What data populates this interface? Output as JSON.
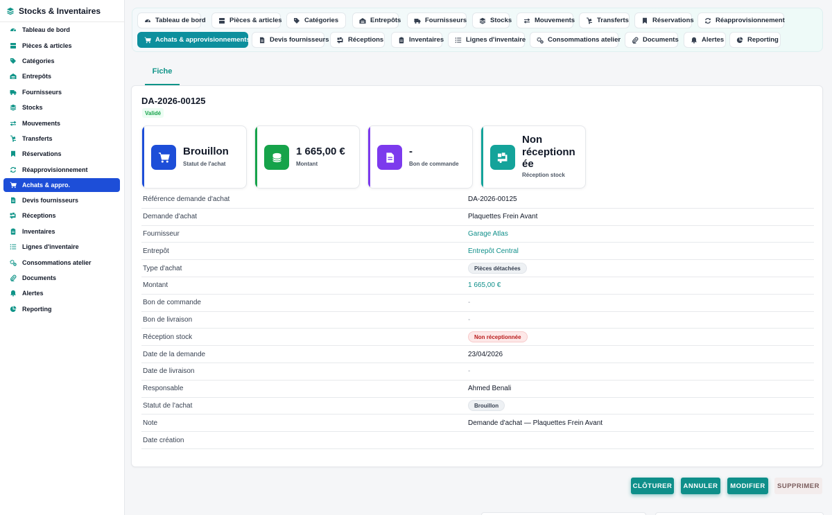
{
  "sidebar": {
    "title": "Stocks & Inventaires",
    "items": [
      {
        "label": "Tableau de bord",
        "icon": "dashboard-icon"
      },
      {
        "label": "Pièces & articles",
        "icon": "parts-icon"
      },
      {
        "label": "Catégories",
        "icon": "tags-icon"
      },
      {
        "label": "Entrepôts",
        "icon": "warehouse-icon"
      },
      {
        "label": "Fournisseurs",
        "icon": "truck-icon"
      },
      {
        "label": "Stocks",
        "icon": "layers-icon"
      },
      {
        "label": "Mouvements",
        "icon": "arrows-icon"
      },
      {
        "label": "Transferts",
        "icon": "dolly-icon"
      },
      {
        "label": "Réservations",
        "icon": "bookmark-icon"
      },
      {
        "label": "Réapprovisionnement",
        "icon": "refresh-icon"
      },
      {
        "label": "Achats & appro.",
        "icon": "cart-icon",
        "active": true
      },
      {
        "label": "Devis fournisseurs",
        "icon": "invoice-icon"
      },
      {
        "label": "Réceptions",
        "icon": "truck-loading-icon"
      },
      {
        "label": "Inventaires",
        "icon": "clipboard-icon"
      },
      {
        "label": "Lignes d'inventaire",
        "icon": "list-icon"
      },
      {
        "label": "Consommations atelier",
        "icon": "cogs-icon"
      },
      {
        "label": "Documents",
        "icon": "paperclip-icon"
      },
      {
        "label": "Alertes",
        "icon": "bell-icon"
      },
      {
        "label": "Reporting",
        "icon": "pie-chart-icon"
      }
    ]
  },
  "tabs": {
    "row1": [
      "Tableau de bord",
      "Pièces & articles",
      "Catégories",
      "Entrepôts",
      "Fournisseurs",
      "Stocks",
      "Mouvements",
      "Transferts",
      "Réservations",
      "Réapprovisionnement"
    ],
    "row2": [
      "Achats & approvisionnements",
      "Devis fournisseurs",
      "Réceptions",
      "Inventaires",
      "Lignes d'inventaire",
      "Consommations atelier",
      "Documents",
      "Alertes",
      "Reporting"
    ]
  },
  "subtab": "Fiche",
  "record": {
    "title": "DA-2026-00125",
    "status": "Validé"
  },
  "stats": [
    {
      "value": "Brouillon",
      "label": "Statut de l'achat",
      "color": "#1d4ed8",
      "icon": "cart-icon"
    },
    {
      "value": "1 665,00 €",
      "label": "Montant",
      "color": "#16a34a",
      "icon": "coins-icon"
    },
    {
      "value": "-",
      "label": "Bon de commande",
      "color": "#7c3aed",
      "icon": "document-icon"
    },
    {
      "value": "Non réceptionnée",
      "value_lines": [
        "Non",
        "réceptionn",
        "ée"
      ],
      "label": "Réception stock",
      "color": "#14a39a",
      "icon": "truck-loading-icon"
    }
  ],
  "fields": [
    {
      "key": "Référence demande d'achat",
      "value": "DA-2026-00125",
      "type": "text"
    },
    {
      "key": "Demande d'achat",
      "value": "Plaquettes Frein Avant",
      "type": "text"
    },
    {
      "key": "Fournisseur",
      "value": "Garage Atlas",
      "type": "link"
    },
    {
      "key": "Entrepôt",
      "value": "Entrepôt Central",
      "type": "link"
    },
    {
      "key": "Type d'achat",
      "value": "Pièces détachées",
      "type": "pill-gray"
    },
    {
      "key": "Montant",
      "value": "1 665,00 €",
      "type": "link"
    },
    {
      "key": "Bon de commande",
      "value": "-",
      "type": "dash"
    },
    {
      "key": "Bon de livraison",
      "value": "-",
      "type": "dash"
    },
    {
      "key": "Réception stock",
      "value": "Non réceptionnée",
      "type": "pill-red"
    },
    {
      "key": "Date de la demande",
      "value": "23/04/2026",
      "type": "text"
    },
    {
      "key": "Date de livraison",
      "value": "-",
      "type": "dash"
    },
    {
      "key": "Responsable",
      "value": "Ahmed Benali",
      "type": "text"
    },
    {
      "key": "Statut de l'achat",
      "value": "Brouillon",
      "type": "pill-gray"
    },
    {
      "key": "Note",
      "value": "Demande d'achat — Plaquettes Frein Avant",
      "type": "text"
    },
    {
      "key": "Date création",
      "value": "",
      "type": "text"
    }
  ],
  "actions": {
    "close": "CLÔTURER",
    "cancel": "ANNULER",
    "edit": "MODIFIER",
    "delete": "SUPPRIMER"
  },
  "colors": {
    "accent": "#0d8f9d",
    "active_nav": "#1d4ed8",
    "link": "#0f8f8a"
  }
}
